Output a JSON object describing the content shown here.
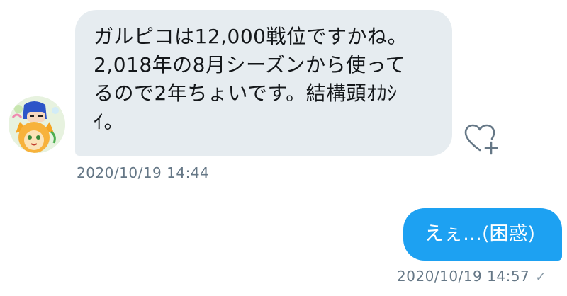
{
  "messages": {
    "received": {
      "text": "ガルピコは12,000戦位ですかね。\n2,018年の8月シーズンから使って\nるので2年ちょいです。結構頭ｵｶｼ\nｲ。",
      "timestamp": "2020/10/19 14:44",
      "avatar_icon": "user-avatar-icon",
      "like_icon": "heart-plus-icon"
    },
    "sent": {
      "text": "えぇ…(困惑)",
      "timestamp": "2020/10/19 14:57",
      "status_icon": "check-icon",
      "status_glyph": "✓"
    }
  },
  "colors": {
    "received_bubble": "#e6ecf0",
    "sent_bubble": "#1da1f2",
    "timestamp": "#657786"
  }
}
